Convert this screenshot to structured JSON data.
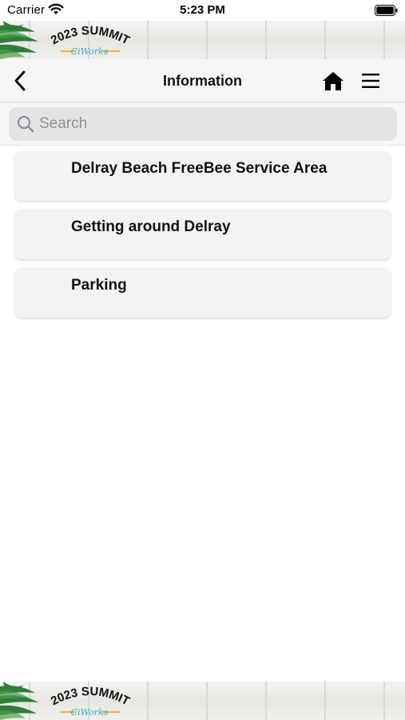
{
  "status_bar": {
    "carrier": "Carrier",
    "time": "5:23 PM"
  },
  "banner": {
    "logo_line1": "2023 SUMMIT",
    "logo_line2": "CiWorks",
    "colors": {
      "logo_text": "#111111",
      "logo_script": "#3aa7d8",
      "logo_line": "#f0b429",
      "palm": "#2f7d3a"
    }
  },
  "header": {
    "title": "Information",
    "back_icon": "chevron-left-icon",
    "home_icon": "home-icon",
    "menu_icon": "hamburger-menu-icon"
  },
  "search": {
    "placeholder": "Search",
    "value": ""
  },
  "list": {
    "items": [
      {
        "label": "Delray Beach FreeBee Service Area"
      },
      {
        "label": "Getting around Delray"
      },
      {
        "label": "Parking"
      }
    ]
  }
}
